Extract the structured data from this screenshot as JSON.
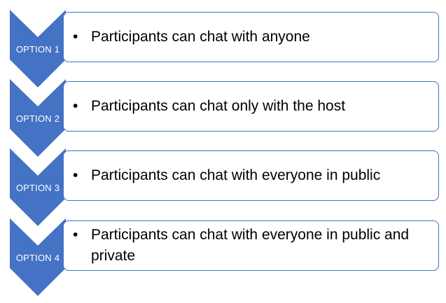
{
  "colors": {
    "chevron_fill": "#4472c4",
    "box_border": "#4472c4",
    "text": "#000000",
    "chevron_text": "#ffffff"
  },
  "steps": [
    {
      "label": "OPTION 1",
      "bullet": "•",
      "text": "Participants can chat with anyone"
    },
    {
      "label": "OPTION 2",
      "bullet": "•",
      "text": "Participants can chat only with the host"
    },
    {
      "label": "OPTION 3",
      "bullet": "•",
      "text": "Participants can chat with everyone in public"
    },
    {
      "label": "OPTION 4",
      "bullet": "•",
      "text": "Participants can chat with everyone in public and private"
    }
  ]
}
